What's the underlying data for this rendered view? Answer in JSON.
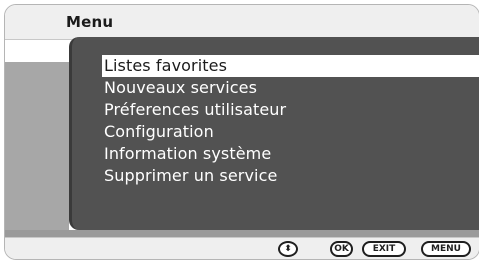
{
  "window": {
    "title": "Menu"
  },
  "menu": {
    "items": [
      {
        "label": "Listes favorites",
        "selected": true
      },
      {
        "label": "Nouveaux services",
        "selected": false
      },
      {
        "label": "Préferences utilisateur",
        "selected": false
      },
      {
        "label": "Configuration",
        "selected": false
      },
      {
        "label": "Information système",
        "selected": false
      },
      {
        "label": "Supprimer un  service",
        "selected": false
      }
    ]
  },
  "footer": {
    "nav_icon": "up-down-arrows-icon",
    "nav_glyph": "⬍",
    "ok_label": "OK",
    "exit_label": "EXIT",
    "menu_label": "MENU"
  },
  "colors": {
    "panel": "#525252",
    "highlight": "#ffffff",
    "side": "#a7a7a7"
  }
}
